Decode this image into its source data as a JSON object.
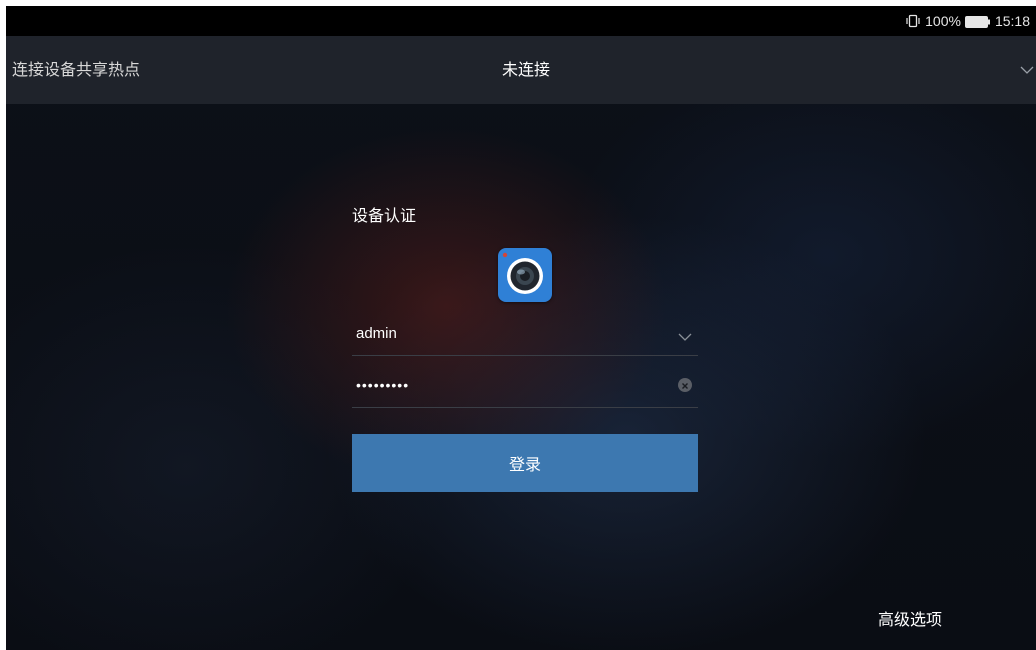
{
  "status_bar": {
    "battery_percent": "100%",
    "time": "15:18",
    "icons": [
      "vibrate-icon",
      "battery-icon"
    ]
  },
  "header": {
    "hotspot_label": "连接设备共享热点",
    "connection_status": "未连接",
    "dropdown_icon": "chevron-down-icon"
  },
  "login": {
    "title": "设备认证",
    "logo_icon": "camera-lens-icon",
    "username_value": "admin",
    "username_dropdown_icon": "chevron-down-icon",
    "password_value": "•••••••••",
    "password_clear_icon": "clear-icon",
    "submit_label": "登录"
  },
  "footer": {
    "advanced_label": "高级选项"
  },
  "colors": {
    "accent": "#3d78b0",
    "logo": "#2f80d6",
    "header_bg": "#1f232b",
    "status_bg": "#000000"
  }
}
